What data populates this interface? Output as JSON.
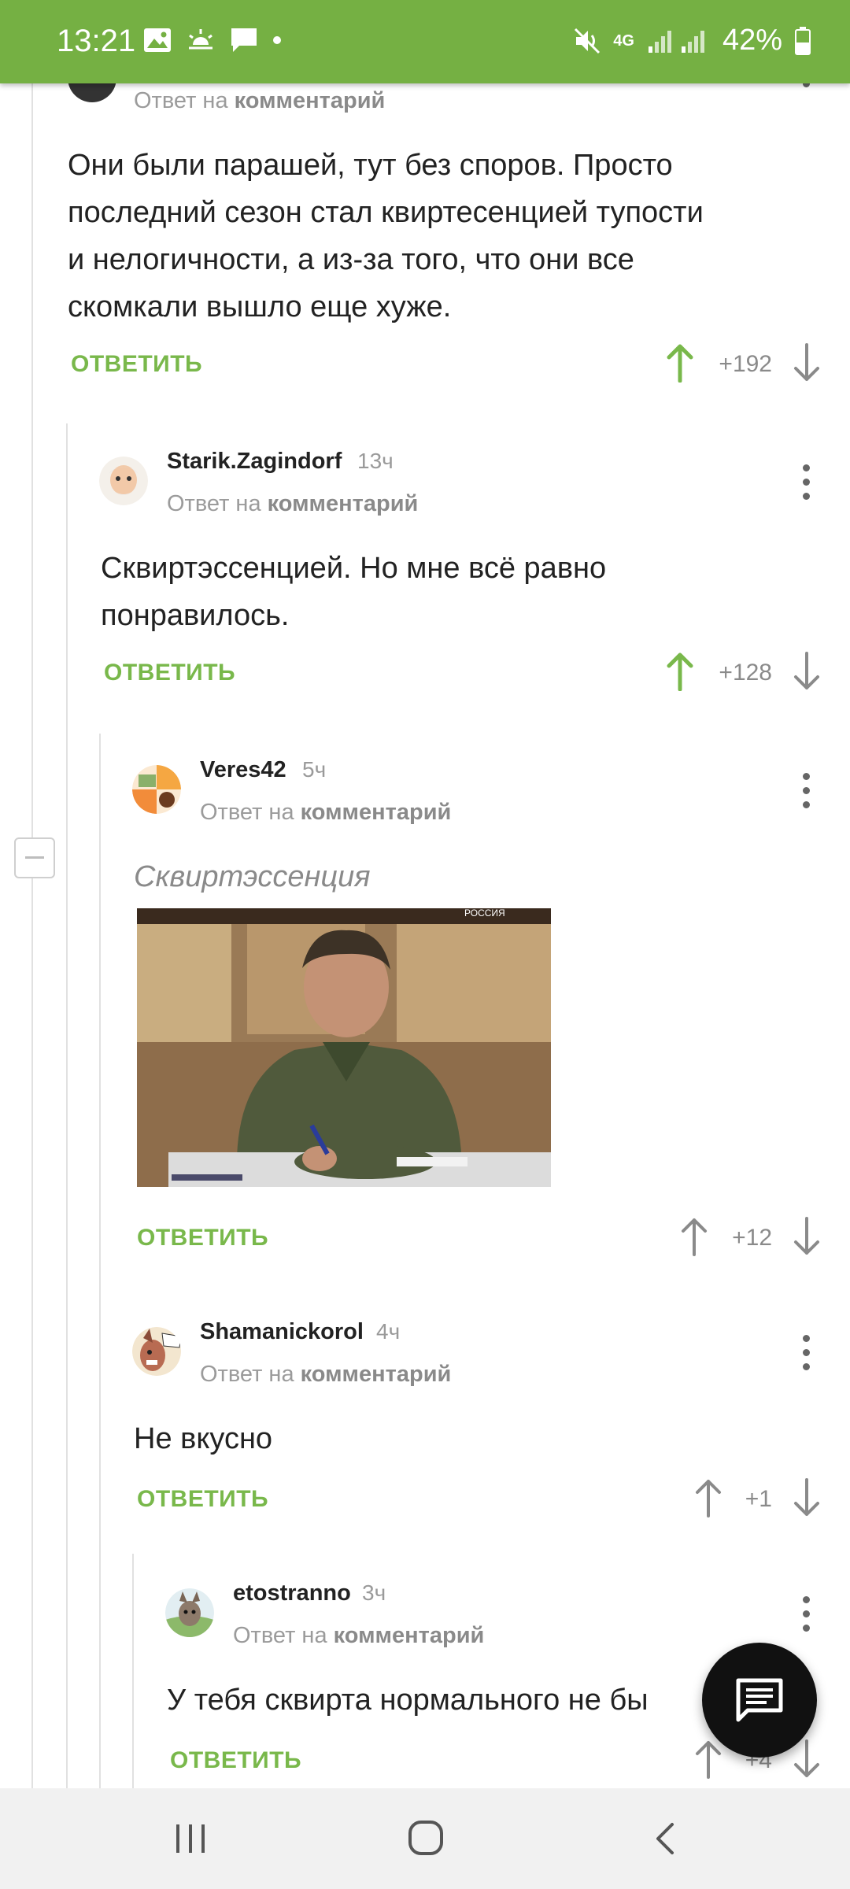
{
  "status_bar": {
    "time": "13:21",
    "network": "4G",
    "battery": "42%",
    "icons": [
      "image-icon",
      "weather-icon",
      "message-icon",
      "mute-icon",
      "signal-icon",
      "battery-icon"
    ]
  },
  "comments": [
    {
      "author": "",
      "age": "",
      "reply_prefix": "Ответ на",
      "reply_target": "комментарий",
      "lines": [
        "Они были парашей, тут без споров. Просто",
        "последний сезон стал квиртесенцией тупости",
        "и нелогичности, а из-за того, что они все",
        "скомкали вышло еще хуже."
      ],
      "reply_label": "ОТВЕТИТЬ",
      "score": "+192"
    },
    {
      "author": "Starik.Zagindorf",
      "age": "13ч",
      "reply_prefix": "Ответ на",
      "reply_target": "комментарий",
      "lines": [
        "Сквиртэссенцией. Но мне всё равно",
        "понравилось."
      ],
      "reply_label": "ОТВЕТИТЬ",
      "score": "+128"
    },
    {
      "author": "Veres42",
      "age": "5ч",
      "reply_prefix": "Ответ на",
      "reply_target": "комментарий",
      "caption": "Сквиртэссенция",
      "image_overlay": "РОССИЯ",
      "reply_label": "ОТВЕТИТЬ",
      "score": "+12"
    },
    {
      "author": "Shamanickorol",
      "age": "4ч",
      "reply_prefix": "Ответ на",
      "reply_target": "комментарий",
      "lines": [
        "Не вкусно"
      ],
      "reply_label": "ОТВЕТИТЬ",
      "score": "+1"
    },
    {
      "author": "etostranno",
      "age": "3ч",
      "reply_prefix": "Ответ на",
      "reply_target": "комментарий",
      "lines": [
        "У тебя сквирта нормального не бы"
      ],
      "reply_label": "ОТВЕТИТЬ",
      "score": "+4"
    }
  ],
  "colors": {
    "accent": "#75b043",
    "reply_link": "#79b84b",
    "upvote": "#79b84b",
    "neutral": "#8a8a8a"
  },
  "nav_bar": {
    "icons": [
      "recent-apps-icon",
      "home-icon",
      "back-icon"
    ]
  }
}
